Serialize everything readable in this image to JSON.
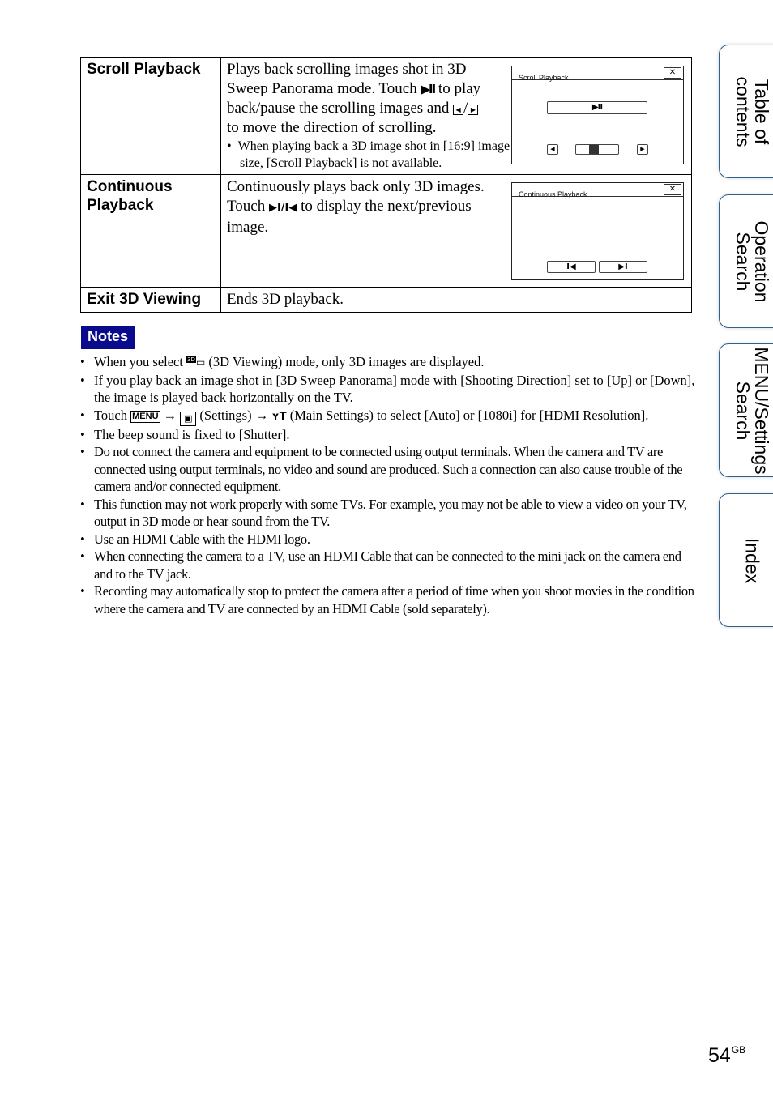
{
  "table": {
    "rows": [
      {
        "name": "Scroll Playback",
        "desc_parts": [
          "Plays back scrolling images shot in 3D Sweep Panorama mode. Touch ",
          " to play back/pause the scrolling images and ",
          "/",
          " to move the direction of scrolling."
        ],
        "icons": {
          "play_pause": "▶II",
          "left": "◀",
          "right": "▶"
        },
        "sub_note": "When playing back a 3D image shot in [16:9] image size, [Scroll Playback] is not available.",
        "screen": {
          "title": "Scroll Playback",
          "close": "✕",
          "play_pause": "▶II",
          "left": "◀",
          "right": "▶",
          "slider_position": 0.4
        }
      },
      {
        "name": "Continuous Playback",
        "desc_parts": [
          "Continuously plays back only 3D images. Touch ",
          " to display the next/previous image."
        ],
        "icons": {
          "next_prev": "▶I/I◀"
        },
        "screen": {
          "title": "Continuous Playback",
          "close": "✕",
          "prev": "I◀",
          "next": "▶I"
        }
      },
      {
        "name": "Exit 3D Viewing",
        "desc": "Ends 3D playback."
      }
    ]
  },
  "notes": {
    "label": "Notes",
    "items": [
      {
        "parts": [
          "When you select ",
          " (3D Viewing) mode, only 3D images are displayed."
        ],
        "icon": "3D"
      },
      {
        "text": "If you play back an image shot in [3D Sweep Panorama] mode with [Shooting Direction] set to [Up] or [Down], the image is played back horizontally on the TV."
      },
      {
        "parts": [
          "Touch ",
          " → ",
          " (Settings) → ",
          " (Main Settings) to select [Auto] or [1080i] for [HDMI Resolution]."
        ],
        "menu_icon": "MENU",
        "settings_icon": "🧰",
        "main_settings_icon": "ʏT"
      },
      {
        "text": "The beep sound is fixed to [Shutter]."
      },
      {
        "text": "Do not connect the camera and equipment to be connected using output terminals. When the camera and TV are connected using output terminals, no video and sound are produced. Such a connection can also cause trouble of the camera and/or connected equipment."
      },
      {
        "text": "This function may not work properly with some TVs. For example, you may not be able to view a video on your TV, output in 3D mode or hear sound from the TV."
      },
      {
        "text": "Use an HDMI Cable with the HDMI logo."
      },
      {
        "text": "When connecting the camera to a TV, use an HDMI Cable that can be connected to the mini jack on the camera end and to the TV jack."
      },
      {
        "text": "Recording may automatically stop to protect the camera after a period of time when you shoot movies in the condition where the camera and TV are connected by an HDMI Cable (sold separately)."
      }
    ]
  },
  "side_tabs": [
    {
      "label": "Table of\ncontents"
    },
    {
      "label": "Operation\nSearch"
    },
    {
      "label": "MENU/Settings\nSearch"
    },
    {
      "label": "Index"
    }
  ],
  "page": {
    "number": "54",
    "suffix": "GB"
  },
  "colors": {
    "notes_badge": "#0a0a8c",
    "tab_border": "#2d5f8f"
  }
}
